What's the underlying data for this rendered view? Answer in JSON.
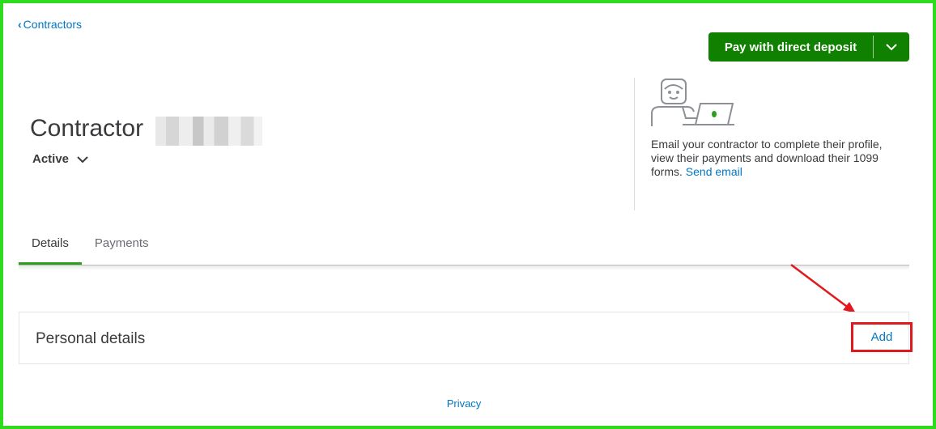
{
  "nav": {
    "back_label": "Contractors"
  },
  "header": {
    "title_prefix": "Contractor",
    "status": "Active",
    "pay_button_label": "Pay with direct deposit"
  },
  "promo": {
    "text": "Email your contractor to complete their profile, view their payments and download their 1099 forms.",
    "link_label": "Send email"
  },
  "tabs": [
    {
      "label": "Details",
      "active": true
    },
    {
      "label": "Payments",
      "active": false
    }
  ],
  "personal_details": {
    "title": "Personal details",
    "add_label": "Add"
  },
  "footer": {
    "privacy_label": "Privacy"
  },
  "colors": {
    "brand_green": "#108000",
    "tab_accent": "#2ca01c",
    "link_blue": "#0077c5",
    "annotation_red": "#e0191e",
    "frame_green": "#2ddc1d"
  }
}
